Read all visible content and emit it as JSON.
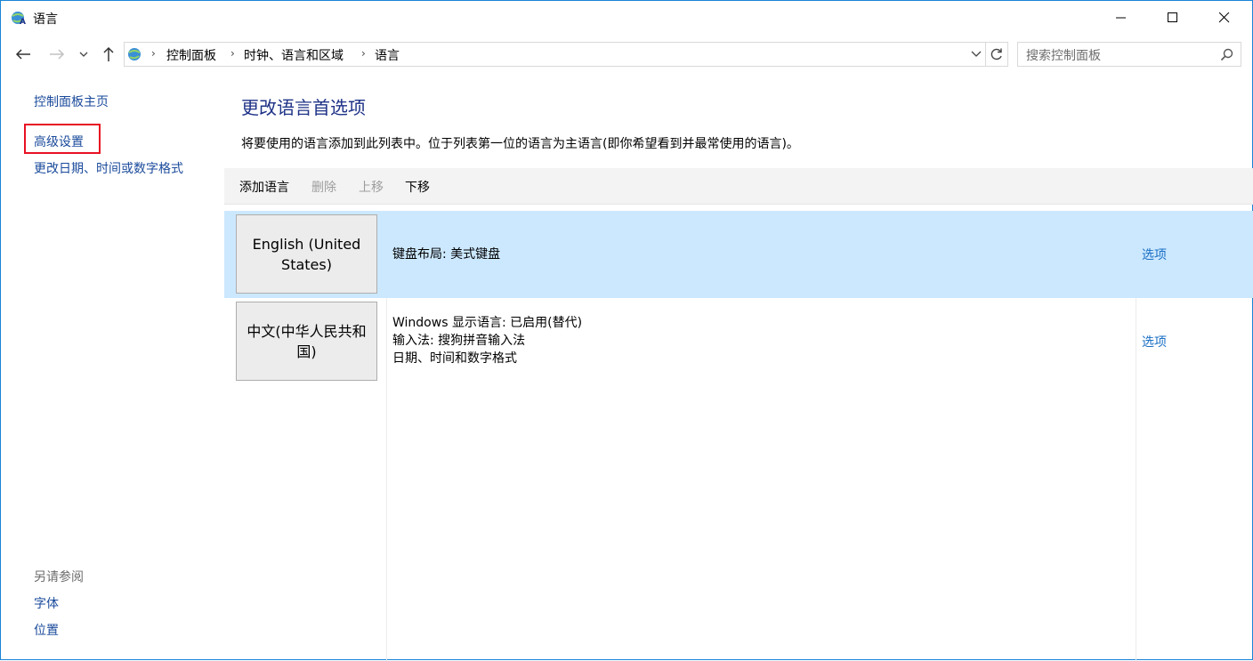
{
  "window": {
    "title": "语言"
  },
  "address": {
    "breadcrumbs": [
      "控制面板",
      "时钟、语言和区域",
      "语言"
    ],
    "search_placeholder": "搜索控制面板"
  },
  "sidebar": {
    "links": [
      "控制面板主页",
      "高级设置",
      "更改日期、时间或数字格式"
    ],
    "see_also_heading": "另请参阅",
    "see_also_links": [
      "字体",
      "位置"
    ]
  },
  "main": {
    "title": "更改语言首选项",
    "description": "将要使用的语言添加到此列表中。位于列表第一位的语言为主语言(即你希望看到并最常使用的语言)。",
    "toolbar": {
      "add": "添加语言",
      "remove": "删除",
      "move_up": "上移",
      "move_down": "下移"
    },
    "languages": [
      {
        "name": "English (United States)",
        "details": [
          "键盘布局: 美式键盘"
        ],
        "options": "选项",
        "selected": true
      },
      {
        "name": "中文(中华人民共和国)",
        "details": [
          "Windows 显示语言: 已启用(替代)",
          "输入法: 搜狗拼音输入法",
          "日期、时间和数字格式"
        ],
        "options": "选项",
        "selected": false
      }
    ]
  },
  "colors": {
    "accent_border": "#1883d7",
    "selected_row": "#cce8ff",
    "title_blue": "#1e3287",
    "link_blue": "#1a6fc4",
    "highlight_red": "#e81123"
  }
}
